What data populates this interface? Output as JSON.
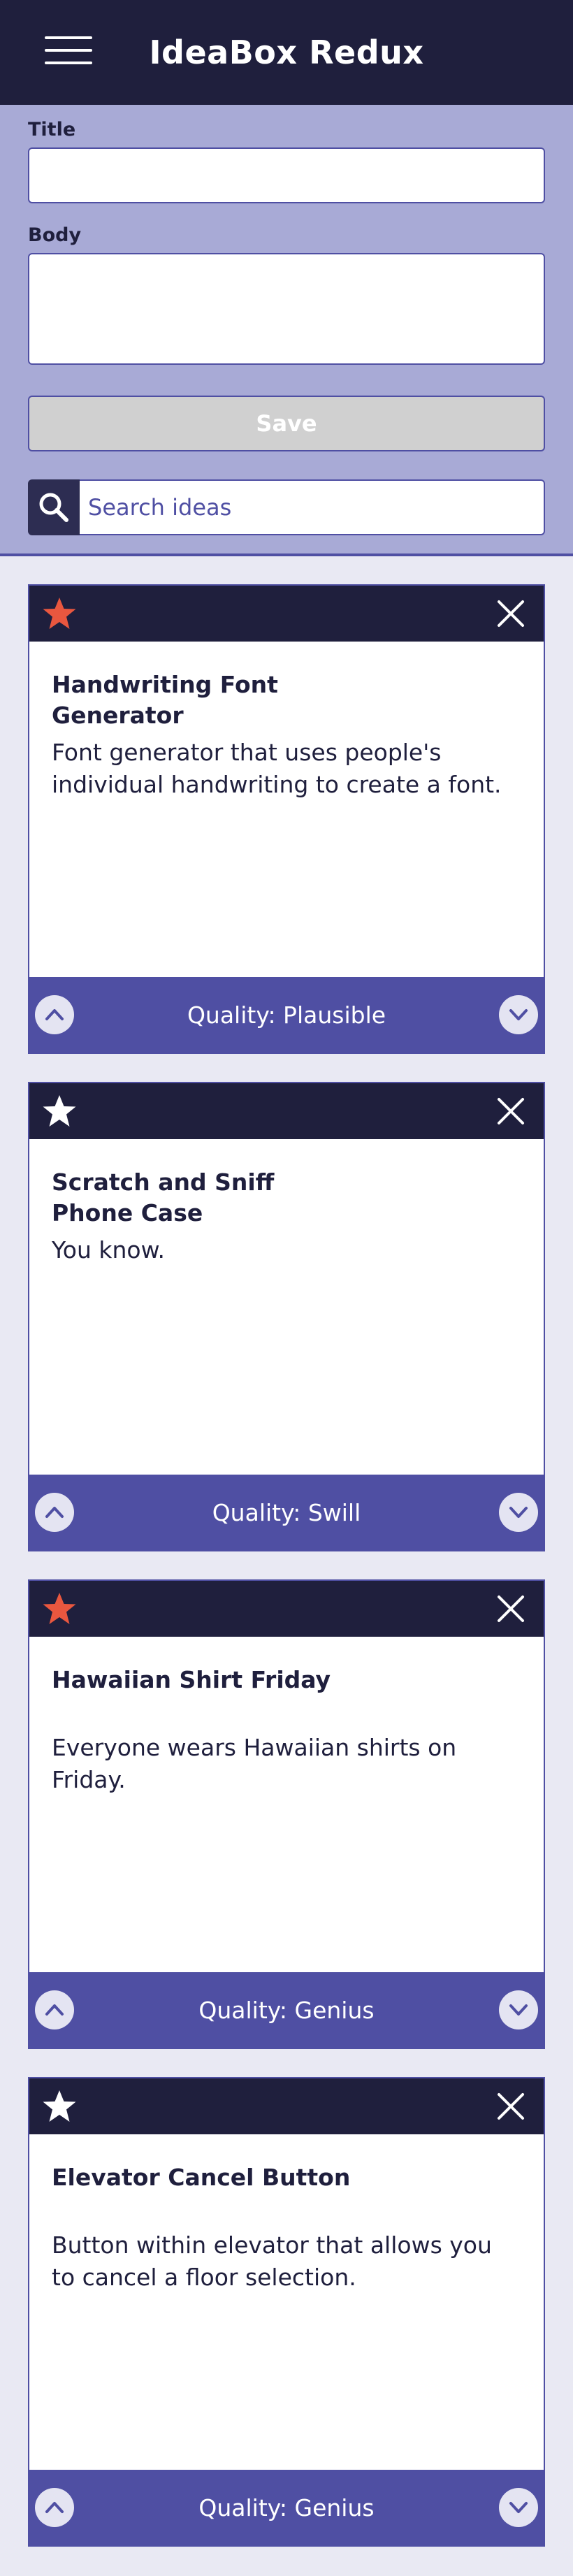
{
  "header": {
    "title": "IdeaBox Redux"
  },
  "form": {
    "title_label": "Title",
    "title_value": "",
    "body_label": "Body",
    "body_value": "",
    "save_label": "Save",
    "search_placeholder": "Search ideas"
  },
  "colors": {
    "header_bg": "#1f1f3d",
    "form_bg": "#a8aad6",
    "accent": "#4f4fa3",
    "star_active": "#e9573f",
    "star_inactive": "#ffffff",
    "page_bg": "#e9e9f3"
  },
  "icons": {
    "menu": "hamburger-icon",
    "search": "search-icon",
    "star": "star-icon",
    "close": "close-icon",
    "upvote": "chevron-up-icon",
    "downvote": "chevron-down-icon"
  },
  "ideas": [
    {
      "title": "Handwriting Font Generator",
      "body": "Font generator that uses people's individual handwriting to create a font.",
      "quality": "Quality: Plausible",
      "starred": true
    },
    {
      "title": "Scratch and Sniff Phone Case",
      "body": "You know.",
      "quality": "Quality: Swill",
      "starred": false
    },
    {
      "title": "Hawaiian Shirt Friday",
      "body": "Everyone wears Hawaiian shirts on Friday.",
      "quality": "Quality: Genius",
      "starred": true
    },
    {
      "title": "Elevator Cancel Button",
      "body": "Button within elevator that allows you to cancel a floor selection.",
      "quality": "Quality: Genius",
      "starred": false
    }
  ]
}
